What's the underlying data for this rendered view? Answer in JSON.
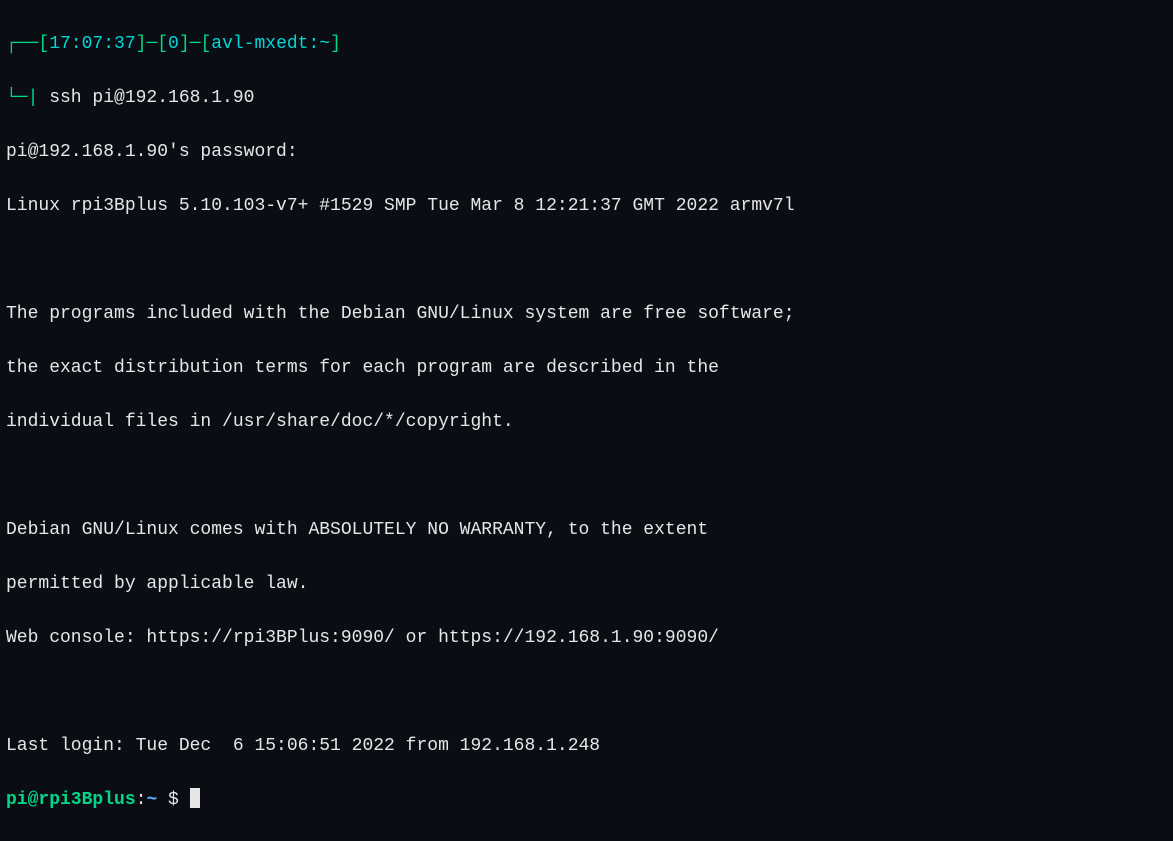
{
  "prompt1": {
    "line1_prefix": "┌──[",
    "time": "17:07:37",
    "sep1": "]─[",
    "jobs": "0",
    "sep2": "]─[",
    "hostpath": "avl-mxedt:~",
    "line1_suffix": "]",
    "line2_prefix": "└─|",
    "command": " ssh pi@192.168.1.90"
  },
  "output": {
    "password_prompt": "pi@192.168.1.90's password:",
    "banner_line1": "Linux rpi3Bplus 5.10.103-v7+ #1529 SMP Tue Mar 8 12:21:37 GMT 2022 armv7l",
    "motd1": "The programs included with the Debian GNU/Linux system are free software;",
    "motd2": "the exact distribution terms for each program are described in the",
    "motd3": "individual files in /usr/share/doc/*/copyright.",
    "motd4": "Debian GNU/Linux comes with ABSOLUTELY NO WARRANTY, to the extent",
    "motd5": "permitted by applicable law.",
    "webconsole": "Web console: https://rpi3BPlus:9090/ or https://192.168.1.90:9090/",
    "lastlogin": "Last login: Tue Dec  6 15:06:51 2022 from 192.168.1.248"
  },
  "prompt2": {
    "userhost": "pi@rpi3Bplus",
    "colon": ":",
    "path": "~ ",
    "dollar": "$ "
  }
}
